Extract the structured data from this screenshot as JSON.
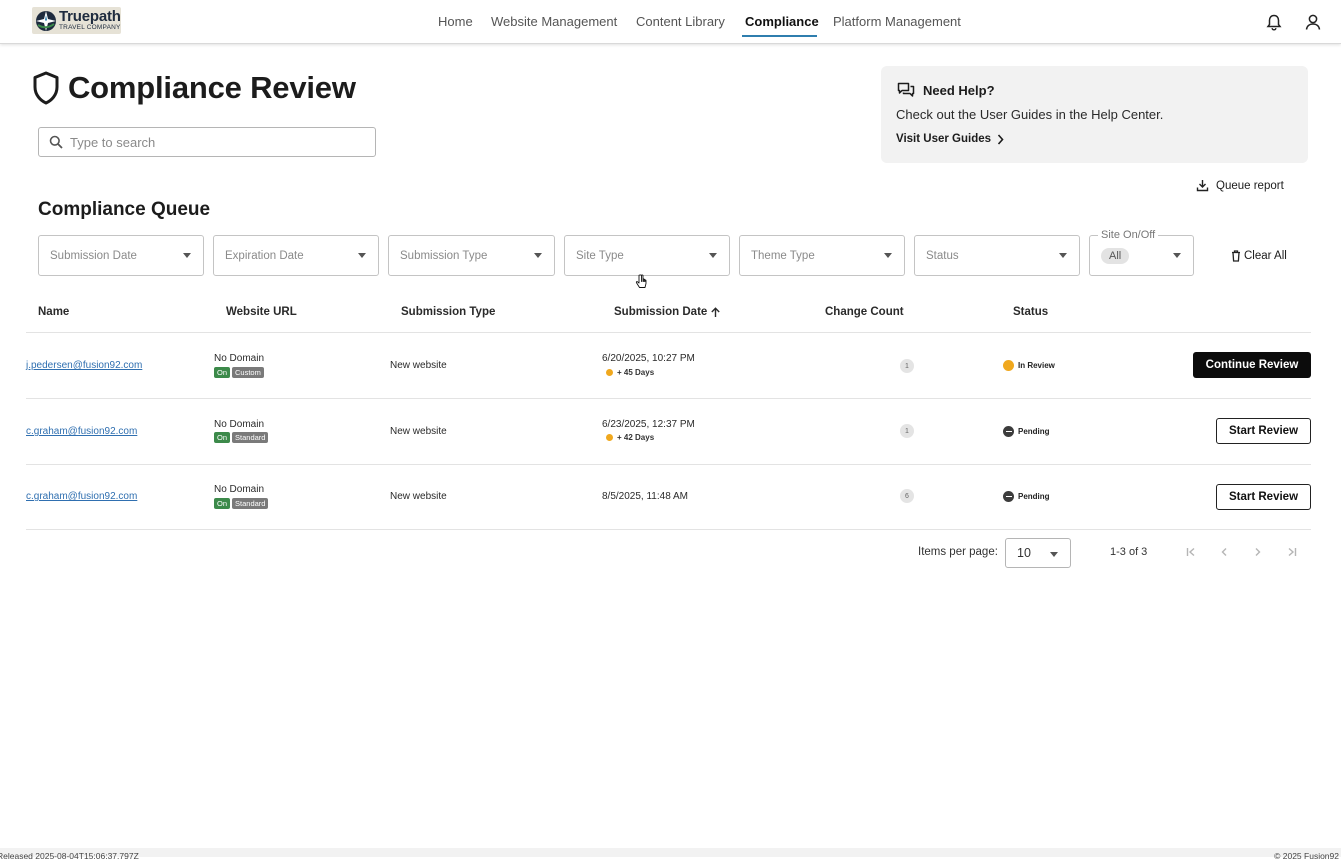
{
  "logo": {
    "title": "Truepath",
    "subtitle": "TRAVEL COMPANY"
  },
  "nav": {
    "items": [
      "Home",
      "Website Management",
      "Content Library",
      "Compliance",
      "Platform Management"
    ],
    "active": "Compliance",
    "accent": "#2f7eae"
  },
  "page": {
    "title": "Compliance Review"
  },
  "search": {
    "placeholder": "Type to search",
    "value": ""
  },
  "help": {
    "title": "Need Help?",
    "text": "Check out the User Guides in the Help Center.",
    "link": "Visit User Guides"
  },
  "queue_report": "Queue report",
  "queue": {
    "title": "Compliance Queue",
    "filters": [
      "Submission Date",
      "Expiration Date",
      "Submission Type",
      "Site Type",
      "Theme Type",
      "Status"
    ],
    "site_toggle": {
      "label": "Site On/Off",
      "value": "All"
    },
    "clear_all": "Clear All"
  },
  "table": {
    "columns": [
      "Name",
      "Website URL",
      "Submission Type",
      "Submission Date",
      "Change Count",
      "Status"
    ],
    "sort_column": "Submission Date",
    "rows": [
      {
        "name": "j.pedersen@fusion92.com",
        "url": "No Domain",
        "site": "On",
        "theme": "Custom",
        "type": "New website",
        "date": "6/20/2025, 10:27 PM",
        "age": "+ 45 Days",
        "count": "1",
        "status": "In Review",
        "action": "Continue Review"
      },
      {
        "name": "c.graham@fusion92.com",
        "url": "No Domain",
        "site": "On",
        "theme": "Standard",
        "type": "New website",
        "date": "6/23/2025, 12:37 PM",
        "age": "+ 42 Days",
        "count": "1",
        "status": "Pending",
        "action": "Start Review"
      },
      {
        "name": "c.graham@fusion92.com",
        "url": "No Domain",
        "site": "On",
        "theme": "Standard",
        "type": "New website",
        "date": "8/5/2025, 11:48 AM",
        "age": "",
        "count": "6",
        "status": "Pending",
        "action": "Start Review"
      }
    ]
  },
  "pagination": {
    "items_label": "Items per page:",
    "per_page": "10",
    "range": "1-3 of 3"
  },
  "footer": {
    "left": "Released 2025-08-04T15:06:37.797Z",
    "right": "© 2025 Fusion92"
  },
  "colors": {
    "in_review": "#f0a81e",
    "pending": "#3c3c3c",
    "tag_on": "#3c8a4a",
    "tag_theme": "#7a7a7a"
  }
}
